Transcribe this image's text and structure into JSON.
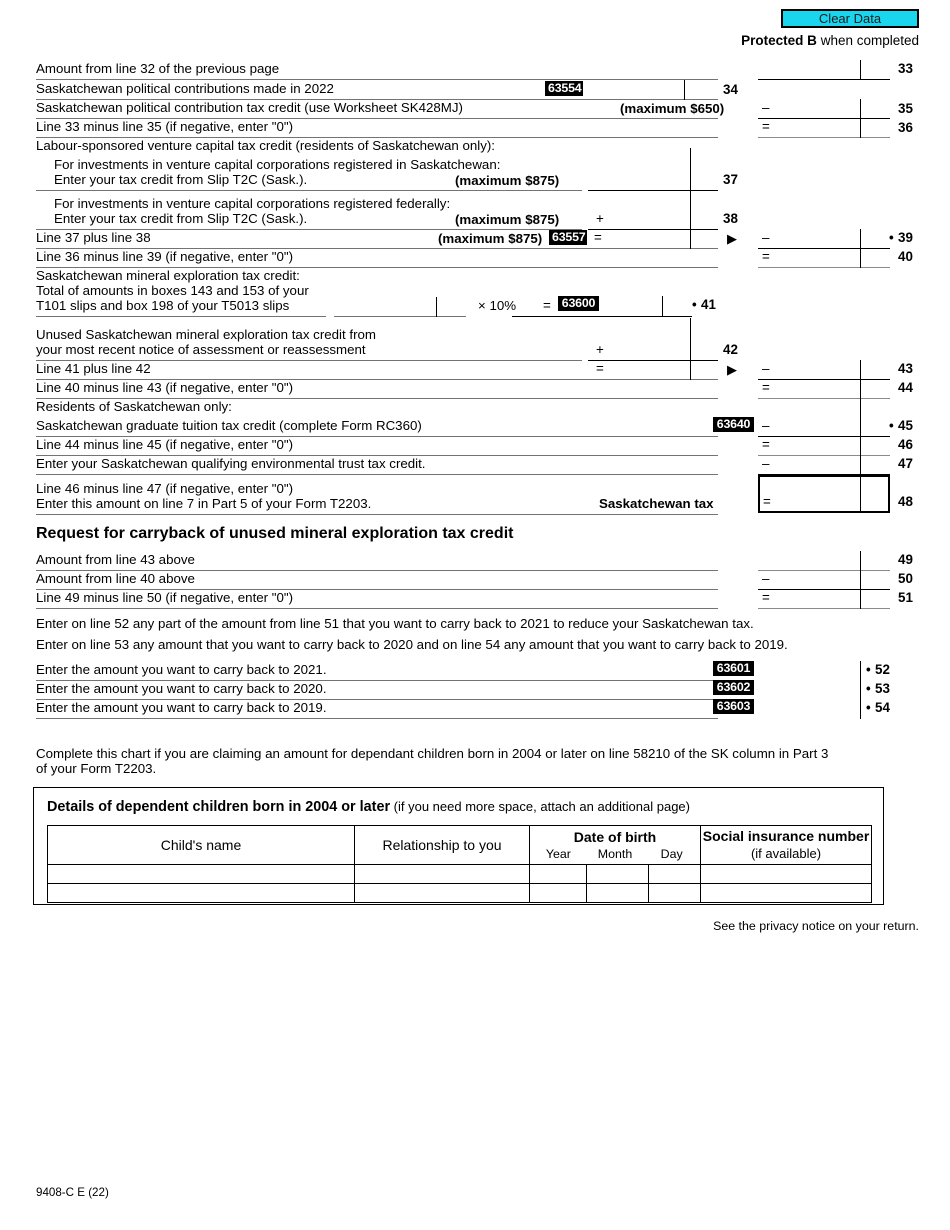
{
  "header": {
    "clear_data_label": "Clear Data",
    "protected_bold": "Protected B",
    "protected_rest": " when completed"
  },
  "rows": {
    "r33": {
      "label": "Amount from line 32 of the previous page",
      "lineno": "33"
    },
    "r34": {
      "label": "Saskatchewan political contributions made in 2022",
      "code": "63554",
      "lineno": "34"
    },
    "r35": {
      "label": "Saskatchewan political contribution tax credit (use Worksheet SK428MJ)",
      "max": "(maximum $650)",
      "op": "–",
      "lineno": "35"
    },
    "r36": {
      "label": "Line 33 minus line 35 (if negative, enter \"0\")",
      "op": "=",
      "lineno": "36"
    },
    "lsvcc_header": "Labour-sponsored venture capital tax credit (residents of Saskatchewan only):",
    "r37": {
      "line1": "For investments in venture capital corporations registered in Saskatchewan:",
      "line2": "Enter your tax credit from Slip T2C (Sask.).",
      "max": "(maximum $875)",
      "lineno": "37"
    },
    "r38": {
      "line1": "For investments in venture capital corporations registered federally:",
      "line2": "Enter your tax credit from Slip T2C (Sask.).",
      "max": "(maximum $875)",
      "op": "+",
      "lineno": "38"
    },
    "r39": {
      "label": "Line 37 plus line 38",
      "max": "(maximum $875)",
      "code": "63557",
      "op_left": "=",
      "arrow": "▶",
      "op_right": "–",
      "lineno": "39",
      "bullet": "•"
    },
    "r40": {
      "label": "Line 36 minus line 39 (if negative, enter \"0\")",
      "op": "=",
      "lineno": "40"
    },
    "r41": {
      "line1": "Saskatchewan mineral exploration tax credit:",
      "line2": "Total of amounts in boxes 143 and 153 of your",
      "line3": "T101 slips and box 198 of your T5013 slips",
      "mult": "×  10%",
      "eq": "=",
      "code": "63600",
      "lineno": "41",
      "bullet": "•"
    },
    "r42": {
      "line1": "Unused Saskatchewan mineral exploration tax credit from",
      "line2": "your most recent notice of assessment or reassessment",
      "op": "+",
      "lineno": "42"
    },
    "r43": {
      "label": "Line 41 plus line 42",
      "op_left": "=",
      "arrow": "▶",
      "op_right": "–",
      "lineno": "43"
    },
    "r44": {
      "label": "Line 40 minus line 43 (if negative, enter \"0\")",
      "op": "=",
      "lineno": "44"
    },
    "residents_header": "Residents of Saskatchewan only:",
    "r45": {
      "label": "Saskatchewan graduate tuition tax credit (complete Form RC360)",
      "code": "63640",
      "op": "–",
      "lineno": "45",
      "bullet": "•"
    },
    "r46": {
      "label": "Line 44 minus line 45 (if negative, enter \"0\")",
      "op": "=",
      "lineno": "46"
    },
    "r47": {
      "label": "Enter your Saskatchewan qualifying environmental trust tax credit.",
      "op": "–",
      "lineno": "47"
    },
    "r48": {
      "line1": "Line 46 minus line 47 (if negative, enter \"0\")",
      "line2": "Enter this amount on line 7 in Part 5 of your Form T2203.",
      "caption": "Saskatchewan tax",
      "op": "=",
      "lineno": "48"
    }
  },
  "carryback": {
    "heading": "Request for carryback of unused mineral exploration tax credit",
    "r49": {
      "label": "Amount from line 43 above",
      "lineno": "49"
    },
    "r50": {
      "label": "Amount from line 40 above",
      "op": "–",
      "lineno": "50"
    },
    "r51": {
      "label": "Line 49 minus line 50 (if negative, enter \"0\")",
      "op": "=",
      "lineno": "51"
    },
    "note1": "Enter on line 52 any part of the amount from line 51 that you want to carry back to 2021 to reduce your Saskatchewan tax.",
    "note2": "Enter on line 53 any amount that you want to carry back to 2020 and on line 54 any amount that you want to carry back to 2019.",
    "r52": {
      "pre": "Enter the amount you want to carry back to ",
      "year": "2021",
      "post": ".",
      "code": "63601",
      "lineno": "52",
      "bullet": "•"
    },
    "r53": {
      "pre": "Enter the amount you want to carry back to ",
      "year": "2020",
      "post": ".",
      "code": "63602",
      "lineno": "53",
      "bullet": "•"
    },
    "r54": {
      "pre": "Enter the amount you want to carry back to ",
      "year": "2019",
      "post": ".",
      "code": "63603",
      "lineno": "54",
      "bullet": "•"
    }
  },
  "children": {
    "intro_line1": "Complete this chart if you are claiming an amount for dependant children born in 2004 or later on line 58210 of the SK column in Part 3",
    "intro_line2": "of your Form T2203.",
    "panel_title_strong": "Details of dependent children born in 2004 or later",
    "panel_title_note": " (if you need more space, attach an additional page)",
    "col_name": "Child's name",
    "col_relationship": "Relationship to you",
    "col_dob": "Date of birth",
    "col_year": "Year",
    "col_month": "Month",
    "col_day": "Day",
    "col_sin": "Social insurance number",
    "col_sin_sub": "(if available)",
    "rows": [
      {
        "name": "",
        "relationship": "",
        "year": "",
        "month": "",
        "day": "",
        "sin": ""
      },
      {
        "name": "",
        "relationship": "",
        "year": "",
        "month": "",
        "day": "",
        "sin": ""
      }
    ]
  },
  "footer": {
    "privacy": "See the privacy notice on your return.",
    "form_id": "9408-C E (22)"
  },
  "colors": {
    "clear_data_bg": "#19d6ee",
    "code_box_bg": "#000000",
    "rule": "#737373"
  }
}
